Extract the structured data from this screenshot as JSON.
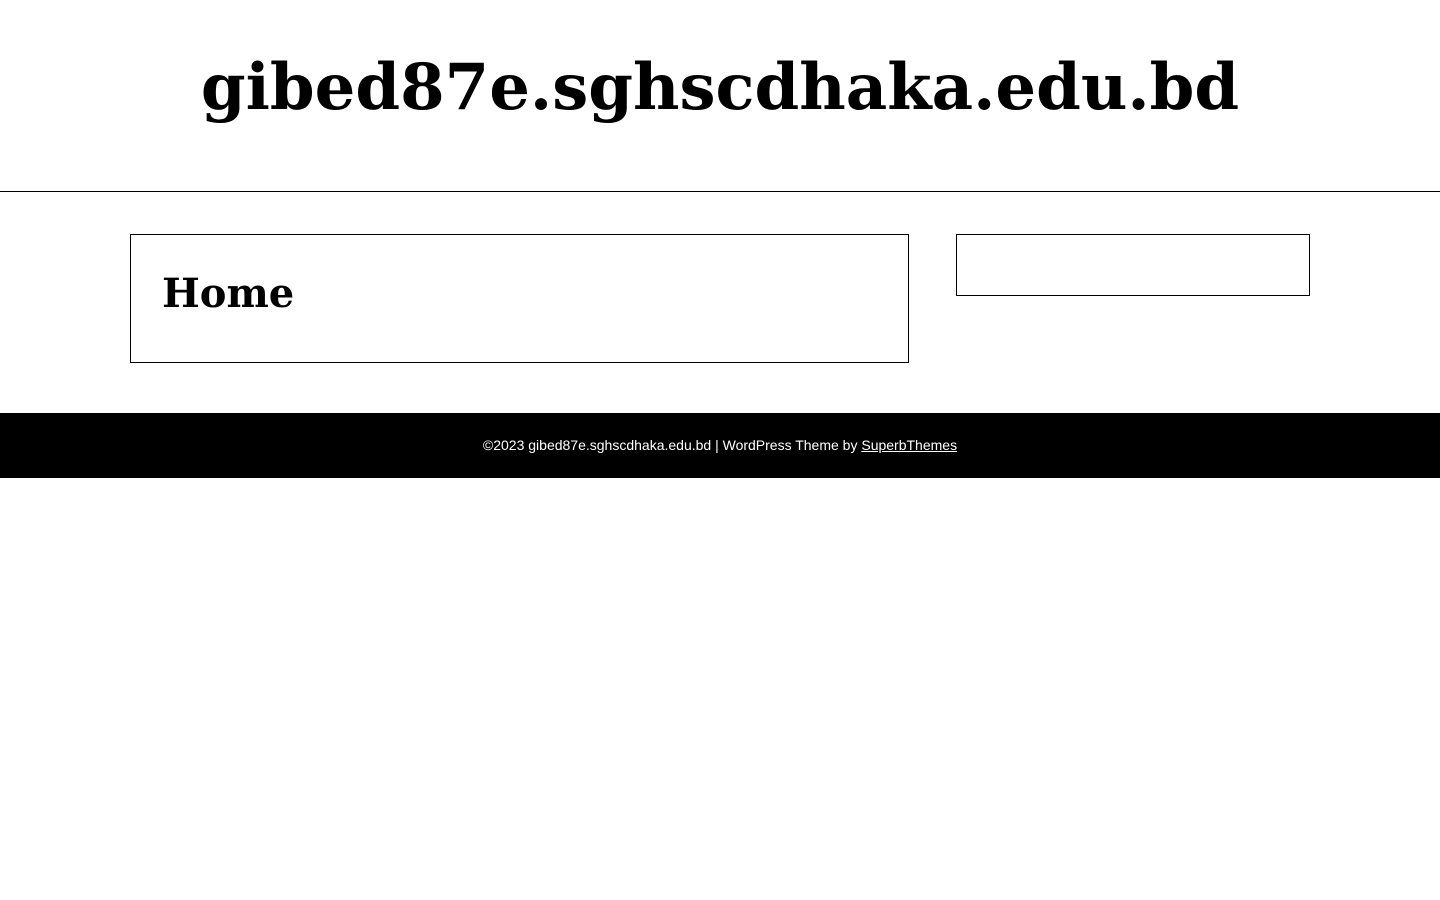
{
  "header": {
    "site_title": "gibed87e.sghscdhaka.edu.bd"
  },
  "main": {
    "page_heading": "Home"
  },
  "footer": {
    "copyright_text": "©2023 gibed87e.sghscdhaka.edu.bd | WordPress Theme by ",
    "theme_link_label": "SuperbThemes"
  },
  "colors": {
    "background": "#ffffff",
    "text": "#000000",
    "footer_background": "#000000",
    "footer_text": "#ffffff"
  }
}
